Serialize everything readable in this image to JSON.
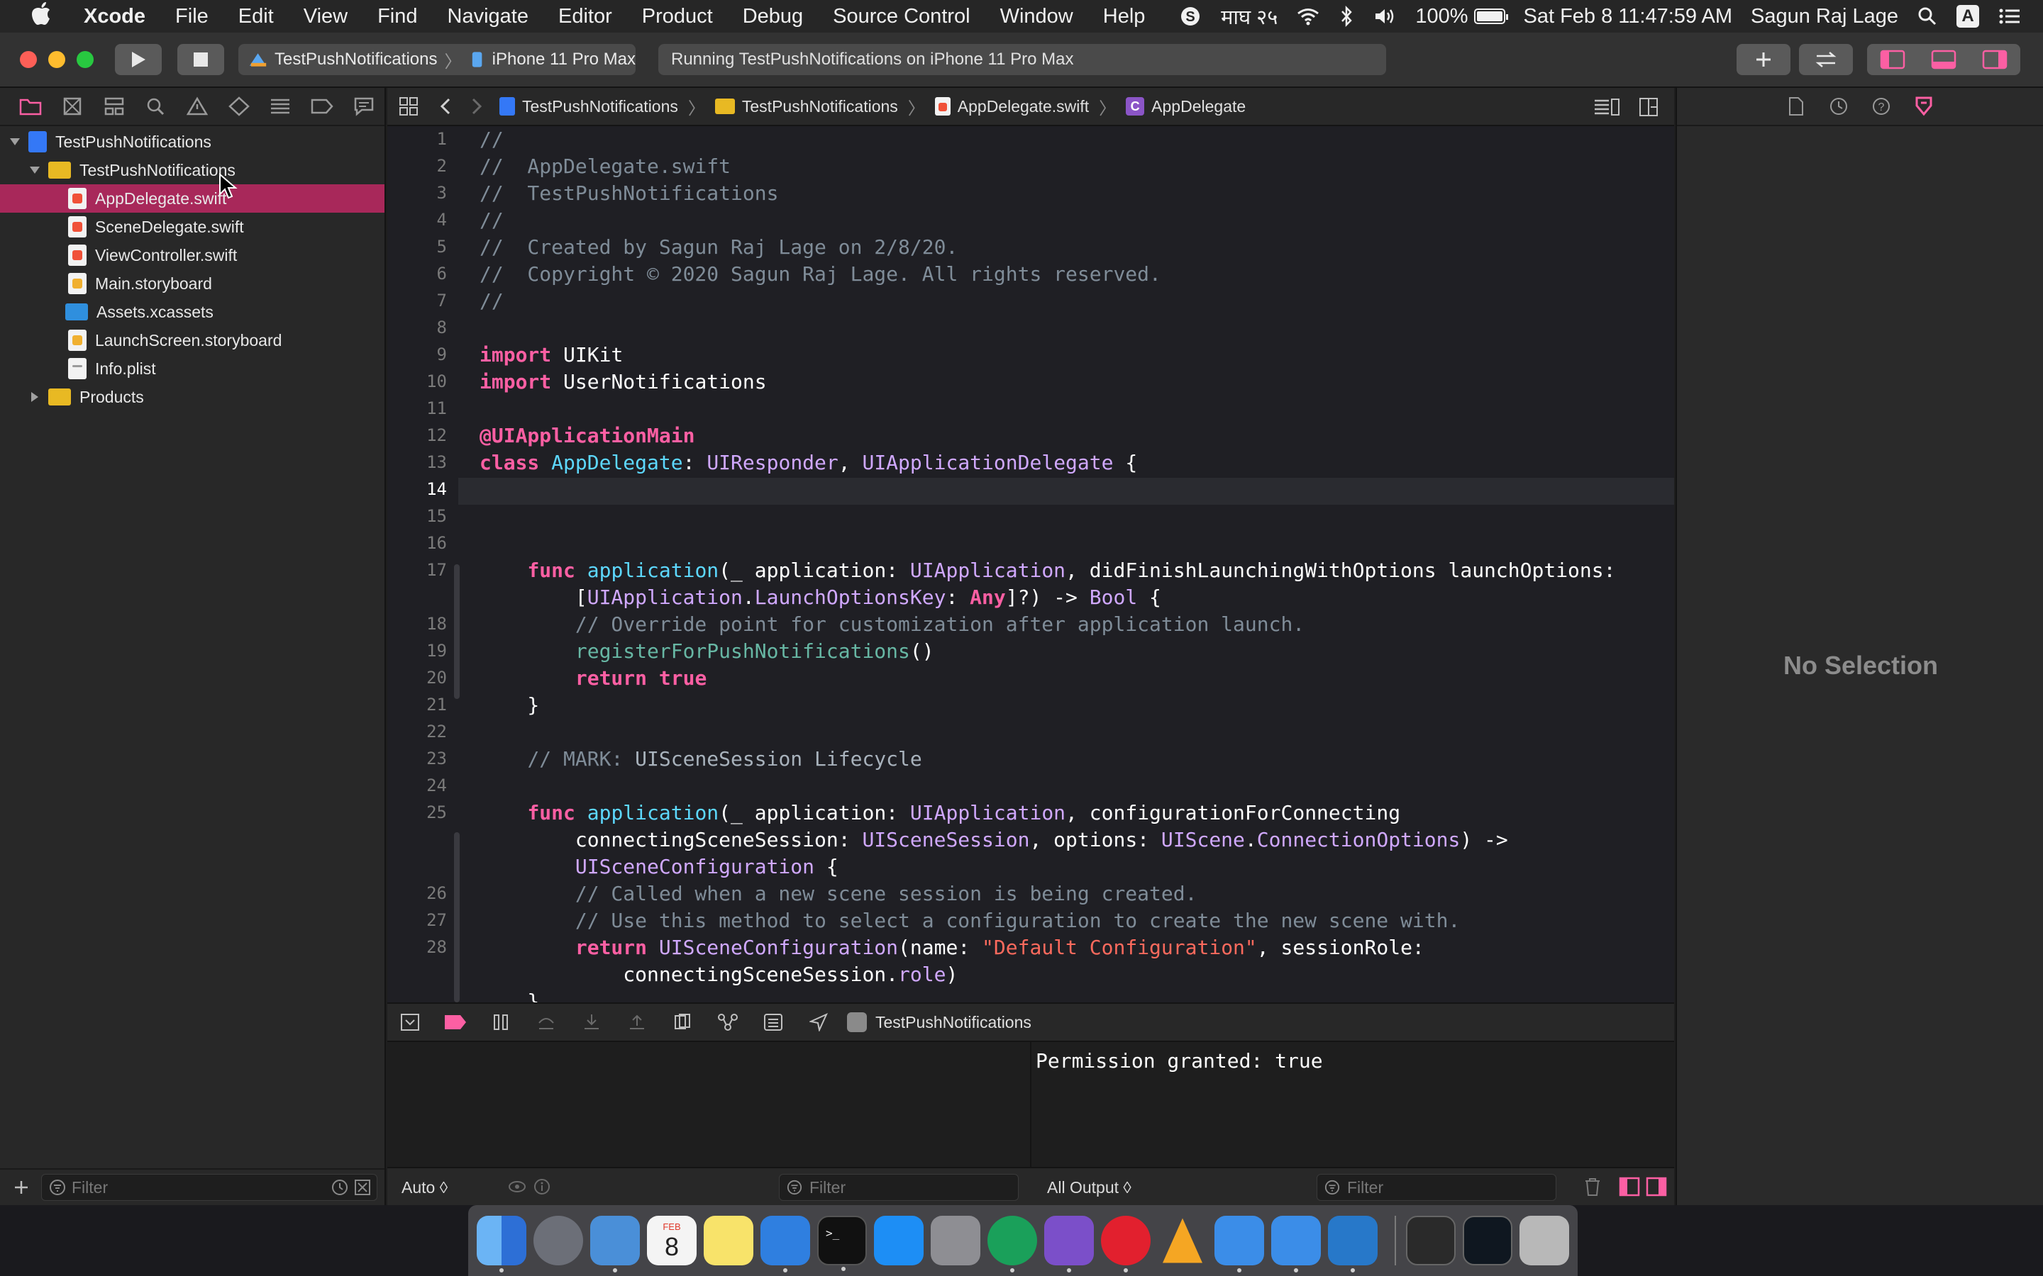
{
  "menubar": {
    "app_name": "Xcode",
    "items": [
      "File",
      "Edit",
      "View",
      "Find",
      "Navigate",
      "Editor",
      "Product",
      "Debug",
      "Source Control",
      "Window",
      "Help"
    ],
    "date_native": "माघ २५",
    "battery_percent": "100%",
    "clock": "Sat Feb 8  11:47:59 AM",
    "user_name": "Sagun Raj Lage",
    "input_source": "A"
  },
  "toolbar": {
    "scheme": "TestPushNotifications",
    "destination": "iPhone 11 Pro Max",
    "status": "Running TestPushNotifications on iPhone 11 Pro Max"
  },
  "navigator": {
    "rows": [
      {
        "label": "TestPushNotifications",
        "kind": "project"
      },
      {
        "label": "TestPushNotifications",
        "kind": "folder"
      },
      {
        "label": "AppDelegate.swift",
        "kind": "swift"
      },
      {
        "label": "SceneDelegate.swift",
        "kind": "swift"
      },
      {
        "label": "ViewController.swift",
        "kind": "swift"
      },
      {
        "label": "Main.storyboard",
        "kind": "storyboard"
      },
      {
        "label": "Assets.xcassets",
        "kind": "assets"
      },
      {
        "label": "LaunchScreen.storyboard",
        "kind": "storyboard"
      },
      {
        "label": "Info.plist",
        "kind": "plist"
      },
      {
        "label": "Products",
        "kind": "folder"
      }
    ],
    "filter_placeholder": "Filter"
  },
  "jumpbar": {
    "crumbs": [
      "TestPushNotifications",
      "TestPushNotifications",
      "AppDelegate.swift",
      "AppDelegate"
    ]
  },
  "editor": {
    "line_numbers": [
      "1",
      "2",
      "3",
      "4",
      "5",
      "6",
      "7",
      "8",
      "9",
      "10",
      "11",
      "12",
      "13",
      "14",
      "15",
      "16",
      "17",
      "18",
      "19",
      "20",
      "21",
      "22",
      "23",
      "24",
      "25",
      "26",
      "27",
      "28"
    ],
    "current_line": "14"
  },
  "debug": {
    "process_name": "TestPushNotifications",
    "variables_scope": "Auto ◊",
    "output_scope": "All Output ◊",
    "filter_placeholder": "Filter",
    "console_output": "Permission granted: true"
  },
  "inspector": {
    "empty_label": "No Selection"
  },
  "colors": {
    "selection": "#a8285a",
    "keyword": "#fc5fa3",
    "type": "#5dd8ff",
    "comment": "#7f8c98",
    "string": "#fc6a5d",
    "attribute": "#fd8f3f"
  }
}
